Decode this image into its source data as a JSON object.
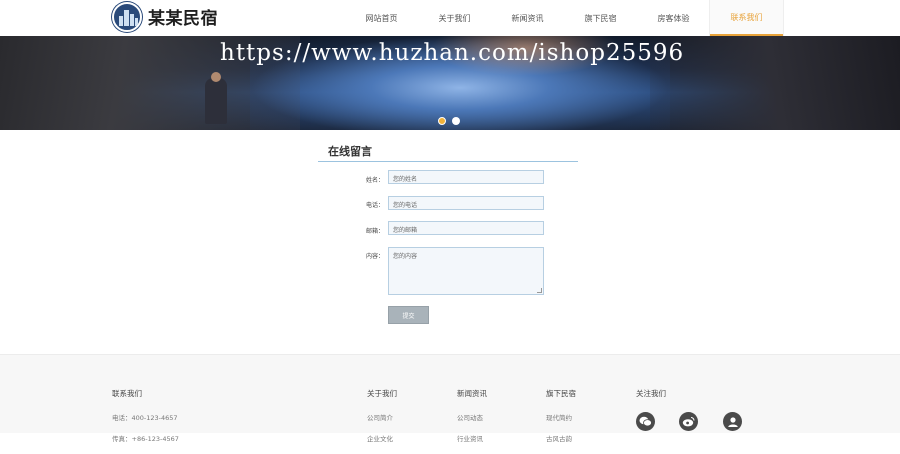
{
  "header": {
    "logo_text": "某某民宿",
    "nav": [
      {
        "label": "网站首页",
        "active": false
      },
      {
        "label": "关于我们",
        "active": false
      },
      {
        "label": "新闻资讯",
        "active": false
      },
      {
        "label": "旗下民宿",
        "active": false
      },
      {
        "label": "房客体验",
        "active": false
      },
      {
        "label": "联系我们",
        "active": true
      }
    ]
  },
  "banner": {
    "watermark": "https://www.huzhan.com/ishop25596",
    "slides": 2,
    "active_slide": 1
  },
  "form": {
    "title": "在线留言",
    "fields": [
      {
        "label": "姓名：",
        "placeholder": "您的姓名"
      },
      {
        "label": "电话：",
        "placeholder": "您的电话"
      },
      {
        "label": "邮箱：",
        "placeholder": "您的邮箱"
      },
      {
        "label": "内容：",
        "placeholder": "您的内容"
      }
    ],
    "submit_label": "提交"
  },
  "footer": {
    "contact": {
      "heading": "联系我们",
      "items": [
        "电话：400-123-4657",
        "传真：+86-123-4567"
      ]
    },
    "about": {
      "heading": "关于我们",
      "items": [
        "公司简介",
        "企业文化"
      ]
    },
    "news": {
      "heading": "新闻资讯",
      "items": [
        "公司动态",
        "行业资讯"
      ]
    },
    "homestays": {
      "heading": "旗下民宿",
      "items": [
        "现代简约",
        "古风古韵"
      ]
    },
    "follow": {
      "heading": "关注我们",
      "icons": [
        "wechat-icon",
        "weibo-icon",
        "user-icon"
      ]
    }
  },
  "colors": {
    "accent": "#e8a33a",
    "field_border": "#b7cfe2",
    "submit_bg": "#a9b3ba"
  }
}
